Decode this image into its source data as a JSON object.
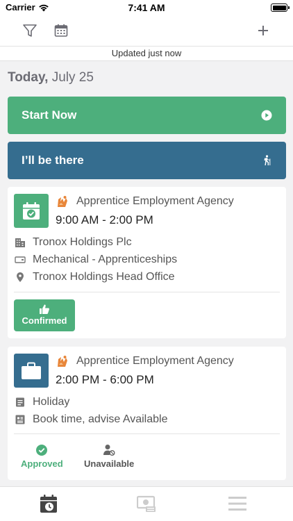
{
  "status_bar": {
    "carrier": "Carrier",
    "time": "7:41 AM"
  },
  "toolbar": {
    "icons": [
      "filter-icon",
      "calendar-icon",
      "plus-icon"
    ]
  },
  "updated": "Updated just now",
  "date": {
    "day": "Today,",
    "date": "July 25"
  },
  "actions": {
    "start_label": "Start Now",
    "there_label": "I’ll be there"
  },
  "cards": [
    {
      "agency": "Apprentice Employment Agency",
      "time_range": "9:00 AM - 2:00 PM",
      "company": "Tronox Holdings Plc",
      "category": "Mechanical - Apprenticeships",
      "location": "Tronox Holdings Head Office",
      "confirm_label": "Confirmed",
      "tile_color": "#4daf7c"
    },
    {
      "agency": "Apprentice Employment Agency",
      "time_range": "2:00 PM - 6:00 PM",
      "type": "Holiday",
      "note": "Book time, advise Available",
      "approved_label": "Approved",
      "unavailable_label": "Unavailable",
      "tile_color": "#356d8f"
    }
  ],
  "tabs": [
    "roster-calendar-icon",
    "timesheet-icon",
    "menu-icon"
  ],
  "colors": {
    "green": "#4daf7c",
    "blue": "#356d8f"
  }
}
